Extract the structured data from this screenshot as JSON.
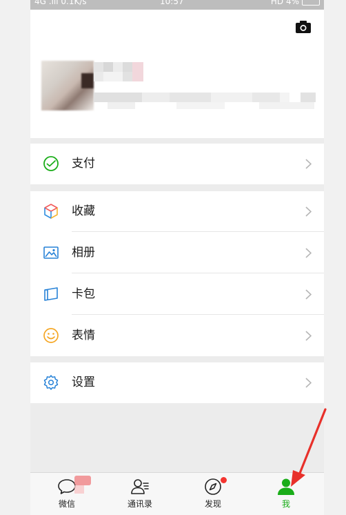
{
  "statusbar": {
    "left": "4G .ıll 0.1K/s",
    "time": "10:57",
    "right": "HD 4%"
  },
  "profile": {
    "camera_icon": "camera-icon",
    "avatar_icon": "avatar-blurred"
  },
  "menu": {
    "pay": {
      "label": "支付",
      "icon": "wechat-pay-icon",
      "color": "#1aad19"
    },
    "favorites": {
      "label": "收藏",
      "icon": "cube-icon"
    },
    "album": {
      "label": "相册",
      "icon": "picture-icon",
      "color": "#2782d7"
    },
    "cards": {
      "label": "卡包",
      "icon": "wallet-icon",
      "color": "#2782d7"
    },
    "stickers": {
      "label": "表情",
      "icon": "smiley-icon",
      "color": "#f5a623"
    },
    "settings": {
      "label": "设置",
      "icon": "gear-icon",
      "color": "#2782d7"
    }
  },
  "tabbar": {
    "tabs": [
      {
        "label": "微信",
        "icon": "chat-icon"
      },
      {
        "label": "通讯录",
        "icon": "contacts-icon"
      },
      {
        "label": "发现",
        "icon": "compass-icon"
      },
      {
        "label": "我",
        "icon": "me-icon",
        "active": true
      }
    ],
    "active_color": "#1aad19",
    "badge_color": "#f43530"
  }
}
